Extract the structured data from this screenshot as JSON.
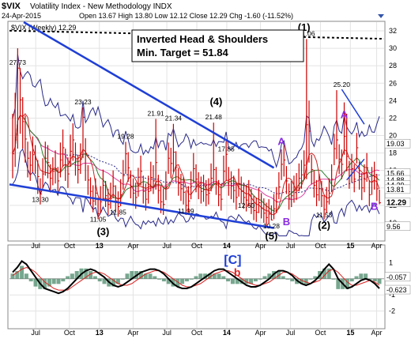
{
  "header": {
    "symbol": "$VIX",
    "name": "Volatility Index - New Methodology",
    "exchange": "INDX",
    "date": "24-Apr-2015",
    "ohlc": "Open 13.67  High 13.80  Low 12.12  Close 12.29  Chg -1.60 (-11.52%)",
    "open": "13.67",
    "high": "13.80",
    "low": "12.12",
    "close": "12.29",
    "chg": "-1.60 (-11.52%)",
    "panel_label": "$VIX (Weekly) 12.29"
  },
  "annotation_box": {
    "line1": "Inverted Head & Shoulders",
    "line2": "Min. Target = 51.84"
  },
  "colors": {
    "price_bar": "#cc0000",
    "trend_blue": "#1f3fd6",
    "band_blue": "#2a2a8a",
    "ma_green": "#2e7d2e",
    "ma_pink": "#e040a0",
    "ma_red": "#cc2222",
    "wave_purple": "#8a2be2",
    "histogram": "#4a8a6a",
    "osc_black": "#000000",
    "osc_red": "#dd2222",
    "grid": "#e3e3e3"
  },
  "chart_data": {
    "type": "line",
    "ylim": [
      8,
      33
    ],
    "x_tick_labels": [
      "Jul",
      "Oct",
      "13",
      "Apr",
      "Jul",
      "Oct",
      "14",
      "Apr",
      "Jul",
      "Oct",
      "15",
      "Apr"
    ],
    "y_tick_labels": [
      "10",
      "12",
      "14",
      "16",
      "18",
      "20",
      "22",
      "24",
      "26",
      "28",
      "30",
      "32"
    ],
    "close_series": [
      17.9,
      19.5,
      27.73,
      24.1,
      21.6,
      19.6,
      17.4,
      16.6,
      17.8,
      17.3,
      15.3,
      13.3,
      15.6,
      17.4,
      16.9,
      15.1,
      15.9,
      16.2,
      14.8,
      17.2,
      18.6,
      16.6,
      15.6,
      18.2,
      19.5,
      17.2,
      16.1,
      17.3,
      22.1,
      17.9,
      14.9,
      13.6,
      12.5,
      13.4,
      11.05,
      12.4,
      14.3,
      13.1,
      12.1,
      12.8,
      14.2,
      12.5,
      11.85,
      13.2,
      15.4,
      17.9,
      16.3,
      14.2,
      13.4,
      12.9,
      14.5,
      15.9,
      13.6,
      12.7,
      13.6,
      15.2,
      14.8,
      16.9,
      13.7,
      12.4,
      12.1,
      14.1,
      17.4,
      16.8,
      18.1,
      16.4,
      14.6,
      13.9,
      13.5,
      11.99,
      12.5,
      14.2,
      16.2,
      15.0,
      14.1,
      13.6,
      13.8,
      13.2,
      13.4,
      15.1,
      16.1,
      14.7,
      13.2,
      12.7,
      15.9,
      17.85,
      14.7,
      14.2,
      13.7,
      12.9,
      14.5,
      13.6,
      12.9,
      12.6,
      13.2,
      12.2,
      11.4,
      11.2,
      12.3,
      11.7,
      11.1,
      10.6,
      11.0,
      10.32,
      11.6,
      12.4,
      14.1,
      16.7,
      17.2,
      14.8,
      12.8,
      13.1,
      13.7,
      14.0,
      15.1,
      15.5,
      16.6,
      21.24,
      20.5,
      16.1,
      14.3,
      13.2,
      13.9,
      13.1,
      11.53,
      12.4,
      13.4,
      15.0,
      18.5,
      19.5,
      17.3,
      16.7,
      19.9,
      17.6,
      15.4,
      16.2,
      15.0,
      18.6,
      15.3,
      14.0,
      15.0,
      16.3,
      13.2,
      14.7,
      15.3,
      13.89,
      12.29
    ],
    "high_series": [
      22.5,
      24.9,
      30.0,
      27.73,
      24.4,
      22.3,
      19.3,
      18.2,
      19.9,
      18.9,
      17.2,
      15.1,
      17.4,
      19.3,
      18.9,
      16.7,
      17.5,
      18.3,
      16.4,
      19.2,
      20.7,
      18.5,
      17.5,
      20.1,
      21.4,
      19.2,
      17.8,
      19.1,
      23.23,
      19.7,
      16.6,
      15.2,
      14.3,
      15.1,
      12.9,
      14.2,
      16.1,
      14.8,
      13.9,
      14.6,
      16.0,
      14.3,
      13.6,
      15.0,
      17.2,
      19.28,
      18.1,
      16.0,
      15.1,
      14.6,
      16.3,
      17.7,
      15.4,
      14.5,
      15.4,
      17.0,
      16.6,
      21.91,
      15.5,
      14.2,
      13.9,
      15.9,
      19.2,
      18.6,
      21.34,
      18.2,
      16.3,
      15.6,
      15.2,
      13.7,
      14.2,
      15.9,
      18.0,
      16.7,
      15.8,
      15.3,
      15.5,
      14.9,
      15.1,
      16.8,
      21.48,
      16.4,
      14.9,
      14.4,
      17.7,
      19.6,
      16.4,
      15.9,
      15.4,
      14.6,
      16.2,
      15.3,
      14.6,
      14.3,
      14.9,
      13.9,
      13.1,
      12.9,
      14.0,
      13.4,
      12.8,
      12.3,
      12.7,
      12.0,
      13.3,
      14.1,
      15.8,
      18.4,
      18.9,
      16.5,
      14.5,
      14.8,
      15.4,
      15.7,
      16.8,
      17.2,
      18.3,
      31.06,
      24.0,
      17.8,
      16.0,
      14.9,
      15.6,
      14.8,
      13.2,
      14.1,
      15.1,
      16.7,
      20.2,
      25.2,
      19.0,
      18.4,
      23.8,
      22.5,
      17.1,
      17.9,
      16.7,
      20.3,
      17.0,
      15.7,
      16.7,
      18.0,
      14.9,
      16.4,
      17.0,
      15.6,
      13.8
    ],
    "low_series": [
      15.1,
      16.4,
      18.5,
      20.2,
      18.5,
      16.9,
      15.2,
      14.8,
      15.8,
      15.6,
      13.3,
      12.1,
      14.0,
      15.4,
      15.1,
      13.5,
      14.3,
      14.5,
      13.3,
      15.2,
      16.4,
      14.8,
      14.0,
      16.4,
      17.1,
      15.4,
      14.5,
      15.6,
      17.4,
      14.8,
      13.2,
      12.1,
      11.2,
      12.0,
      10.4,
      11.1,
      12.7,
      11.8,
      10.9,
      11.6,
      12.8,
      11.2,
      10.7,
      11.9,
      13.8,
      15.6,
      14.7,
      12.8,
      12.0,
      11.6,
      13.0,
      14.3,
      12.2,
      11.4,
      12.2,
      13.6,
      13.3,
      13.8,
      12.2,
      11.1,
      10.9,
      12.6,
      15.6,
      15.1,
      15.8,
      14.7,
      13.1,
      12.5,
      12.1,
      10.9,
      11.2,
      12.7,
      14.6,
      13.5,
      12.7,
      12.2,
      12.4,
      11.9,
      12.1,
      13.6,
      14.5,
      13.2,
      11.9,
      11.4,
      14.3,
      14.8,
      13.1,
      12.7,
      12.3,
      11.5,
      13.0,
      12.2,
      11.6,
      11.3,
      11.9,
      11.0,
      10.3,
      10.1,
      11.1,
      10.5,
      10.0,
      9.6,
      9.9,
      10.28,
      10.4,
      11.1,
      12.7,
      14.9,
      15.3,
      13.3,
      11.5,
      11.8,
      12.3,
      12.6,
      13.6,
      13.9,
      14.9,
      15.0,
      16.9,
      14.4,
      12.9,
      11.9,
      12.5,
      11.8,
      10.4,
      11.1,
      12.1,
      13.5,
      16.6,
      17.3,
      15.6,
      15.0,
      17.8,
      15.9,
      13.9,
      14.6,
      13.5,
      16.8,
      13.8,
      12.6,
      13.5,
      14.7,
      11.9,
      13.2,
      13.8,
      12.5,
      12.12
    ],
    "price_labels": [
      {
        "text": "27.73",
        "x": 2,
        "y": 27.73
      },
      {
        "text": "23.23",
        "x": 28,
        "y": 23.23
      },
      {
        "text": "19.28",
        "x": 45,
        "y": 19.28
      },
      {
        "text": "13.30",
        "x": 11,
        "y": 13.3
      },
      {
        "text": "11.05",
        "x": 34,
        "y": 11.05
      },
      {
        "text": "21.91",
        "x": 57,
        "y": 21.91
      },
      {
        "text": "21.34",
        "x": 64,
        "y": 21.34
      },
      {
        "text": "11.85",
        "x": 42,
        "y": 11.85
      },
      {
        "text": "11.99",
        "x": 69,
        "y": 11.99
      },
      {
        "text": "21.48",
        "x": 80,
        "y": 21.48
      },
      {
        "text": "17.85",
        "x": 85,
        "y": 17.85
      },
      {
        "text": "12.60",
        "x": 93,
        "y": 12.6
      },
      {
        "text": "10.28",
        "x": 103,
        "y": 10.28
      },
      {
        "text": "31.06",
        "x": 117,
        "y": 31.06
      },
      {
        "text": "25.20",
        "x": 131,
        "y": 25.2
      },
      {
        "text": "11.53",
        "x": 124,
        "y": 11.53
      }
    ],
    "right_axis_labels": [
      {
        "text": "19.03",
        "y": 19.03,
        "bg": "#ffffff",
        "fg": "#000000"
      },
      {
        "text": "15.66",
        "y": 15.66,
        "bg": "#ffffff",
        "fg": "#000000"
      },
      {
        "text": "14.88",
        "y": 14.88,
        "bg": "#ffffff",
        "fg": "#000000"
      },
      {
        "text": "14.29",
        "y": 14.29,
        "bg": "#ffffff",
        "fg": "#000000"
      },
      {
        "text": "13.81",
        "y": 13.81,
        "bg": "#ffffff",
        "fg": "#000000"
      },
      {
        "text": "12.29",
        "y": 12.29,
        "bg": "#ffffff",
        "fg": "#000000"
      },
      {
        "text": "9.56",
        "y": 9.56,
        "bg": "#ffffff",
        "fg": "#000000"
      }
    ],
    "wave_labels": [
      {
        "text": "(4)",
        "x": 81,
        "y": 23.5,
        "color": "#000000"
      },
      {
        "text": "(3)",
        "x": 36,
        "y": 8.6,
        "color": "#000000"
      },
      {
        "text": "(2)",
        "x": 124,
        "y": 9.3,
        "color": "#000000"
      },
      {
        "text": "(1)",
        "x": 116,
        "y": 32.0,
        "color": "#000000"
      },
      {
        "text": "(5)",
        "x": 103,
        "y": 8.1,
        "color": "#000000"
      },
      {
        "text": "A",
        "x": 107,
        "y": 18.9,
        "color": "#8a2be2"
      },
      {
        "text": "B",
        "x": 109,
        "y": 9.7,
        "color": "#8a2be2"
      },
      {
        "text": "A",
        "x": 132,
        "y": 22.0,
        "color": "#8a2be2"
      },
      {
        "text": "B",
        "x": 144,
        "y": 11.5,
        "color": "#8a2be2"
      }
    ],
    "oscillator": {
      "ylim": [
        -3,
        2
      ],
      "ticks": [
        "1",
        "-1",
        "-2"
      ],
      "labels": [
        "-0.057",
        "-0.623"
      ],
      "marker": "b",
      "wave_label": "[C]",
      "black": [
        0.4,
        0.7,
        1.1,
        0.9,
        0.5,
        0.1,
        -0.3,
        -0.6,
        -0.7,
        -0.8,
        -0.9,
        -0.8,
        -0.6,
        -0.3,
        0.0,
        0.3,
        0.5,
        0.6,
        0.5,
        0.3,
        0.1,
        -0.2,
        -0.4,
        -0.5,
        -0.4,
        -0.2,
        0.0,
        0.2,
        0.4,
        0.5,
        0.6,
        0.6,
        0.5,
        0.3,
        0.0,
        -0.3,
        -0.5,
        -0.6,
        -0.6,
        -0.5,
        -0.3,
        -0.1,
        0.1,
        0.3,
        0.5,
        0.6,
        0.6,
        0.4,
        0.2,
        0.0,
        -0.2,
        -0.4,
        -0.5,
        -0.5,
        -0.4,
        -0.2,
        0.0,
        0.3,
        0.5,
        0.5,
        0.4,
        0.2,
        -0.1,
        -0.3,
        -0.4,
        -0.3,
        -0.1,
        0.2,
        0.6,
        0.9,
        0.6,
        0.0,
        -0.3,
        -0.6,
        -0.5,
        -0.3,
        -0.1,
        0.0,
        -0.1,
        -0.3,
        -0.6
      ],
      "red": [
        0.2,
        0.4,
        0.6,
        0.7,
        0.6,
        0.4,
        0.1,
        -0.2,
        -0.4,
        -0.6,
        -0.7,
        -0.7,
        -0.7,
        -0.5,
        -0.3,
        -0.1,
        0.1,
        0.3,
        0.4,
        0.4,
        0.3,
        0.1,
        -0.1,
        -0.3,
        -0.4,
        -0.4,
        -0.3,
        -0.1,
        0.1,
        0.3,
        0.4,
        0.5,
        0.5,
        0.4,
        0.2,
        0.0,
        -0.2,
        -0.4,
        -0.5,
        -0.5,
        -0.4,
        -0.3,
        -0.1,
        0.1,
        0.3,
        0.4,
        0.5,
        0.5,
        0.4,
        0.2,
        0.0,
        -0.2,
        -0.3,
        -0.4,
        -0.4,
        -0.3,
        -0.2,
        0.0,
        0.2,
        0.4,
        0.4,
        0.3,
        0.1,
        -0.1,
        -0.2,
        -0.3,
        -0.2,
        -0.1,
        0.2,
        0.5,
        0.6,
        0.4,
        0.1,
        -0.2,
        -0.4,
        -0.4,
        -0.3,
        -0.2,
        -0.1,
        -0.2,
        -0.4
      ]
    }
  }
}
